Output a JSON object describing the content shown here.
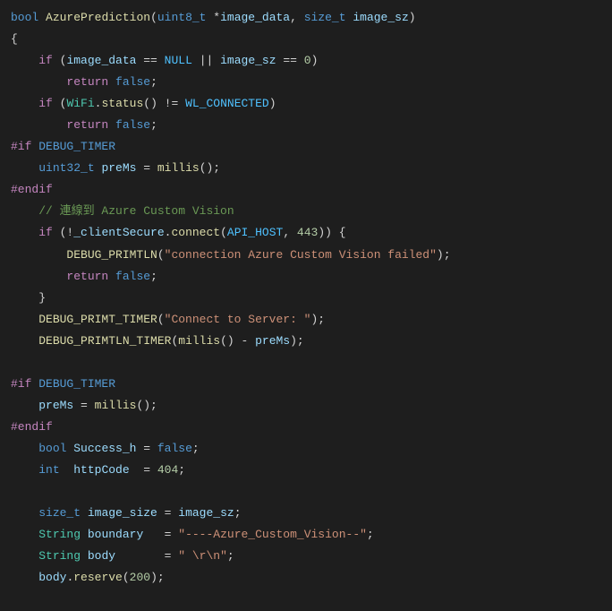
{
  "code": {
    "l1": {
      "t1": "bool",
      "t2": "AzurePrediction",
      "t3": "uint8_t",
      "t4": "image_data",
      "t5": "size_t",
      "t6": "image_sz"
    },
    "l2": {
      "t1": "{"
    },
    "l3": {
      "t1": "if",
      "t2": "image_data",
      "t3": "NULL",
      "t4": "image_sz",
      "t5": "0"
    },
    "l4": {
      "t1": "return",
      "t2": "false"
    },
    "l5": {
      "t1": "if",
      "t2": "WiFi",
      "t3": "status",
      "t4": "WL_CONNECTED"
    },
    "l6": {
      "t1": "return",
      "t2": "false"
    },
    "l7": {
      "t1": "#if",
      "t2": "DEBUG_TIMER"
    },
    "l8": {
      "t1": "uint32_t",
      "t2": "preMs",
      "t3": "millis"
    },
    "l9": {
      "t1": "#endif"
    },
    "l10": {
      "t1": "// 連線到 Azure Custom Vision"
    },
    "l11": {
      "t1": "if",
      "t2": "_clientSecure",
      "t3": "connect",
      "t4": "API_HOST",
      "t5": "443"
    },
    "l12": {
      "t1": "DEBUG_PRIMTLN",
      "t2": "\"connection Azure Custom Vision failed\""
    },
    "l13": {
      "t1": "return",
      "t2": "false"
    },
    "l14": {
      "t1": "}"
    },
    "l15": {
      "t1": "DEBUG_PRIMT_TIMER",
      "t2": "\"Connect to Server: \""
    },
    "l16": {
      "t1": "DEBUG_PRIMTLN_TIMER",
      "t2": "millis",
      "t3": "preMs"
    },
    "l17": {
      "t1": "#if",
      "t2": "DEBUG_TIMER"
    },
    "l18": {
      "t1": "preMs",
      "t2": "millis"
    },
    "l19": {
      "t1": "#endif"
    },
    "l20": {
      "t1": "bool",
      "t2": "Success_h",
      "t3": "false"
    },
    "l21": {
      "t1": "int",
      "t2": "httpCode",
      "t3": "404"
    },
    "l22": {
      "t1": "size_t",
      "t2": "image_size",
      "t3": "image_sz"
    },
    "l23": {
      "t1": "String",
      "t2": "boundary",
      "t3": "\"----Azure_Custom_Vision--\""
    },
    "l24": {
      "t1": "String",
      "t2": "body",
      "t3": "\" \\r\\n\""
    },
    "l25": {
      "t1": "body",
      "t2": "reserve",
      "t3": "200"
    }
  }
}
